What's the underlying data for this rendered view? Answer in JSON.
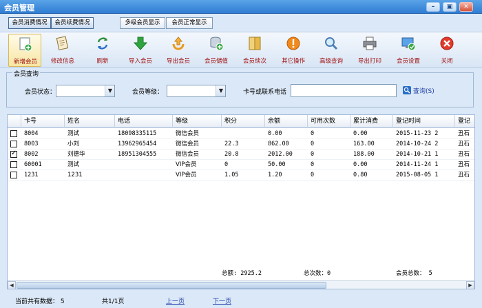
{
  "window": {
    "title": "会员管理",
    "controls": [
      "minimize-icon",
      "restore-icon",
      "close-icon"
    ]
  },
  "tabs": {
    "left": [
      "会员消费情况",
      "会员续费情况"
    ],
    "right": [
      "多级会员显示",
      "会员正常显示"
    ]
  },
  "toolbar": {
    "items": [
      {
        "label": "新增会员",
        "icon": "add-member-icon"
      },
      {
        "label": "修改信息",
        "icon": "edit-document-icon"
      },
      {
        "label": "刷新",
        "icon": "refresh-icon"
      },
      {
        "label": "导入会员",
        "icon": "import-arrow-icon"
      },
      {
        "label": "导出会员",
        "icon": "export-arrow-icon"
      },
      {
        "label": "会员储值",
        "icon": "database-deposit-icon"
      },
      {
        "label": "会员续次",
        "icon": "renew-times-icon"
      },
      {
        "label": "其它操作",
        "icon": "warning-icon"
      },
      {
        "label": "高级查询",
        "icon": "magnifier-icon"
      },
      {
        "label": "导出打印",
        "icon": "printer-icon"
      },
      {
        "label": "会员设置",
        "icon": "settings-monitor-icon"
      },
      {
        "label": "关闭",
        "icon": "close-circle-icon"
      }
    ]
  },
  "query": {
    "legend": "会员查询",
    "status_label": "会员状态：",
    "status_value": "",
    "level_label": "会员等级：",
    "level_value": "",
    "card_label": "卡号或联系电话",
    "card_value": "",
    "search_label": "查询(S)"
  },
  "grid": {
    "columns": [
      "",
      "卡号",
      "姓名",
      "电话",
      "等级",
      "积分",
      "余额",
      "可用次数",
      "累计消费",
      "登记时间",
      "登记"
    ],
    "rows": [
      {
        "checked": false,
        "cells": [
          "8004",
          "测试",
          "18098335115",
          "微信会员",
          "",
          "0.00",
          "0",
          "0.00",
          "2015-11-23 2",
          "丑石"
        ]
      },
      {
        "checked": false,
        "cells": [
          "8003",
          "小刘",
          "13962965454",
          "微信会员",
          "22.3",
          "862.00",
          "0",
          "163.00",
          "2014-10-24 2",
          "丑石"
        ]
      },
      {
        "checked": true,
        "cells": [
          "8002",
          "刘德华",
          "18951304555",
          "微信会员",
          "20.8",
          "2012.00",
          "0",
          "188.00",
          "2014-10-21 1",
          "丑石"
        ]
      },
      {
        "checked": false,
        "cells": [
          "60001",
          "测试",
          "",
          "VIP会员",
          "0",
          "50.00",
          "0",
          "0.00",
          "2014-11-24 1",
          "丑石"
        ]
      },
      {
        "checked": false,
        "cells": [
          "1231",
          "1231",
          "",
          "VIP会员",
          "1.05",
          "1.20",
          "0",
          "0.80",
          "2015-08-05 1",
          "丑石"
        ]
      }
    ],
    "footer": {
      "total_amount": "总额: 2925.2",
      "total_times": "总次数：0",
      "total_members": "会员总数： 5"
    }
  },
  "status": {
    "count_text": "当前共有数据： 5",
    "page_text": "共1/1页",
    "prev": "上一页",
    "next": "下一页"
  },
  "colors": {
    "accent": "#2f7dd3",
    "toolbar_label": "#a01010",
    "link": "#1f3fa8"
  }
}
